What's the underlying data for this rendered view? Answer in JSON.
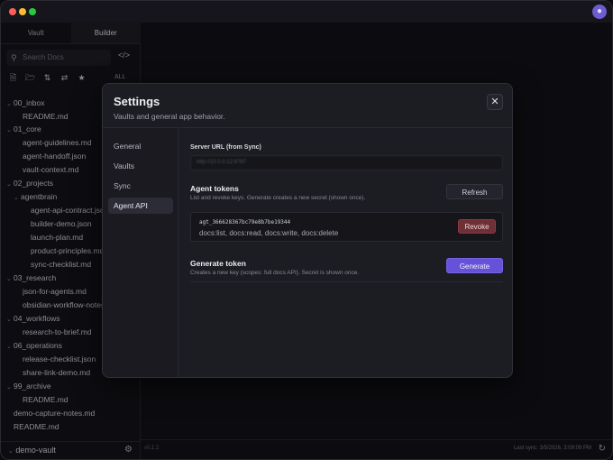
{
  "window": {
    "colors": {
      "close": "#ff5f57",
      "minimize": "#febc2e",
      "maximize": "#28c840",
      "accent": "#6552d8",
      "danger": "#6e2f35"
    },
    "brand_icon": "brain-icon"
  },
  "sidebar": {
    "tabs": [
      {
        "label": "Vault"
      },
      {
        "label": "Builder"
      }
    ],
    "search_placeholder": "Search Docs",
    "toolbar_icons": [
      "new-file-icon",
      "new-folder-icon",
      "sort-icon",
      "collapse-icon",
      "star-icon"
    ],
    "all_label": "ALL",
    "tree": [
      {
        "label": "00_inbox",
        "type": "folder"
      },
      {
        "label": "README.md",
        "type": "file"
      },
      {
        "label": "01_core",
        "type": "folder"
      },
      {
        "label": "agent-guidelines.md",
        "type": "file"
      },
      {
        "label": "agent-handoff.json",
        "type": "file"
      },
      {
        "label": "vault-context.md",
        "type": "file"
      },
      {
        "label": "02_projects",
        "type": "folder"
      },
      {
        "label": "agentbrain",
        "type": "folder"
      },
      {
        "label": "agent-api-contract.json",
        "type": "file"
      },
      {
        "label": "builder-demo.json",
        "type": "file"
      },
      {
        "label": "launch-plan.md",
        "type": "file"
      },
      {
        "label": "product-principles.md",
        "type": "file"
      },
      {
        "label": "sync-checklist.md",
        "type": "file"
      },
      {
        "label": "03_research",
        "type": "folder"
      },
      {
        "label": "json-for-agents.md",
        "type": "file"
      },
      {
        "label": "obsidian-workflow-notes.md",
        "type": "file"
      },
      {
        "label": "04_workflows",
        "type": "folder"
      },
      {
        "label": "research-to-brief.md",
        "type": "file"
      },
      {
        "label": "06_operations",
        "type": "folder"
      },
      {
        "label": "release-checklist.json",
        "type": "file"
      },
      {
        "label": "share-link-demo.md",
        "type": "file"
      },
      {
        "label": "99_archive",
        "type": "folder"
      },
      {
        "label": "README.md",
        "type": "file"
      },
      {
        "label": "demo-capture-notes.md",
        "type": "file"
      },
      {
        "label": "README.md",
        "type": "file"
      }
    ],
    "vault_name": "demo-vault"
  },
  "statusbar": {
    "version": "v0.1.2",
    "last_sync": "Last sync: 3/5/2026, 3:09:09 PM"
  },
  "settings": {
    "title": "Settings",
    "subtitle": "Vaults and general app behavior.",
    "nav": [
      {
        "label": "General"
      },
      {
        "label": "Vaults"
      },
      {
        "label": "Sync"
      },
      {
        "label": "Agent API"
      }
    ],
    "active_nav": "Agent API",
    "server_url_label": "Server URL (from Sync)",
    "server_url_value": "http://10.0.0.12:8787",
    "agent_tokens_title": "Agent tokens",
    "agent_tokens_desc": "List and revoke keys. Generate creates a new secret (shown once).",
    "refresh_label": "Refresh",
    "tokens": [
      {
        "id": "agt_366628367bc79e8b7be19344",
        "scopes": "docs:list, docs:read, docs:write, docs:delete",
        "revoke_label": "Revoke"
      }
    ],
    "generate_title": "Generate token",
    "generate_desc": "Creates a new key (scopes: full docs API). Secret is shown once.",
    "generate_label": "Generate"
  }
}
